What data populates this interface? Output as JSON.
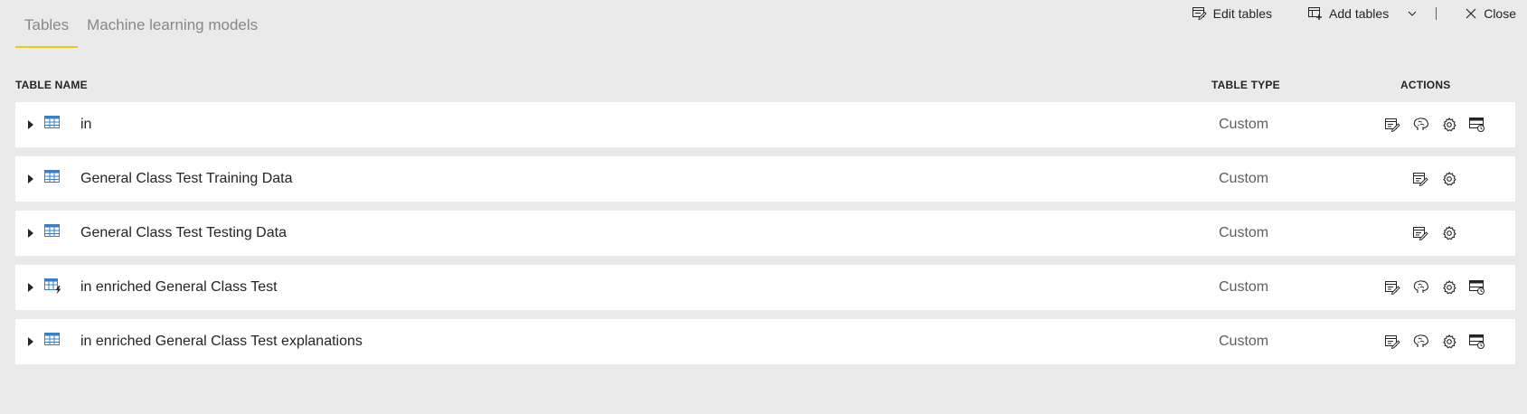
{
  "tabs": [
    {
      "label": "Tables",
      "active": true
    },
    {
      "label": "Machine learning models",
      "active": false
    }
  ],
  "toolbar": {
    "edit_tables": "Edit tables",
    "add_tables": "Add tables",
    "close": "Close"
  },
  "columns": {
    "name": "TABLE NAME",
    "type": "TABLE TYPE",
    "actions": "ACTIONS"
  },
  "accent_color": "#f2c811",
  "rows": [
    {
      "name": "in",
      "type": "Custom",
      "icon": "table-icon",
      "actions": [
        "edit-icon",
        "brain-icon",
        "gear-icon",
        "incremental-refresh-icon"
      ]
    },
    {
      "name": "General Class Test Training Data",
      "type": "Custom",
      "icon": "table-icon",
      "actions": [
        "edit-icon",
        "gear-icon"
      ]
    },
    {
      "name": "General Class Test Testing Data",
      "type": "Custom",
      "icon": "table-icon",
      "actions": [
        "edit-icon",
        "gear-icon"
      ]
    },
    {
      "name": "in enriched General Class Test",
      "type": "Custom",
      "icon": "computed-table-icon",
      "actions": [
        "edit-icon",
        "brain-icon",
        "gear-icon",
        "incremental-refresh-icon"
      ]
    },
    {
      "name": "in enriched General Class Test explanations",
      "type": "Custom",
      "icon": "table-icon",
      "actions": [
        "edit-icon",
        "brain-icon",
        "gear-icon",
        "incremental-refresh-icon"
      ]
    }
  ]
}
